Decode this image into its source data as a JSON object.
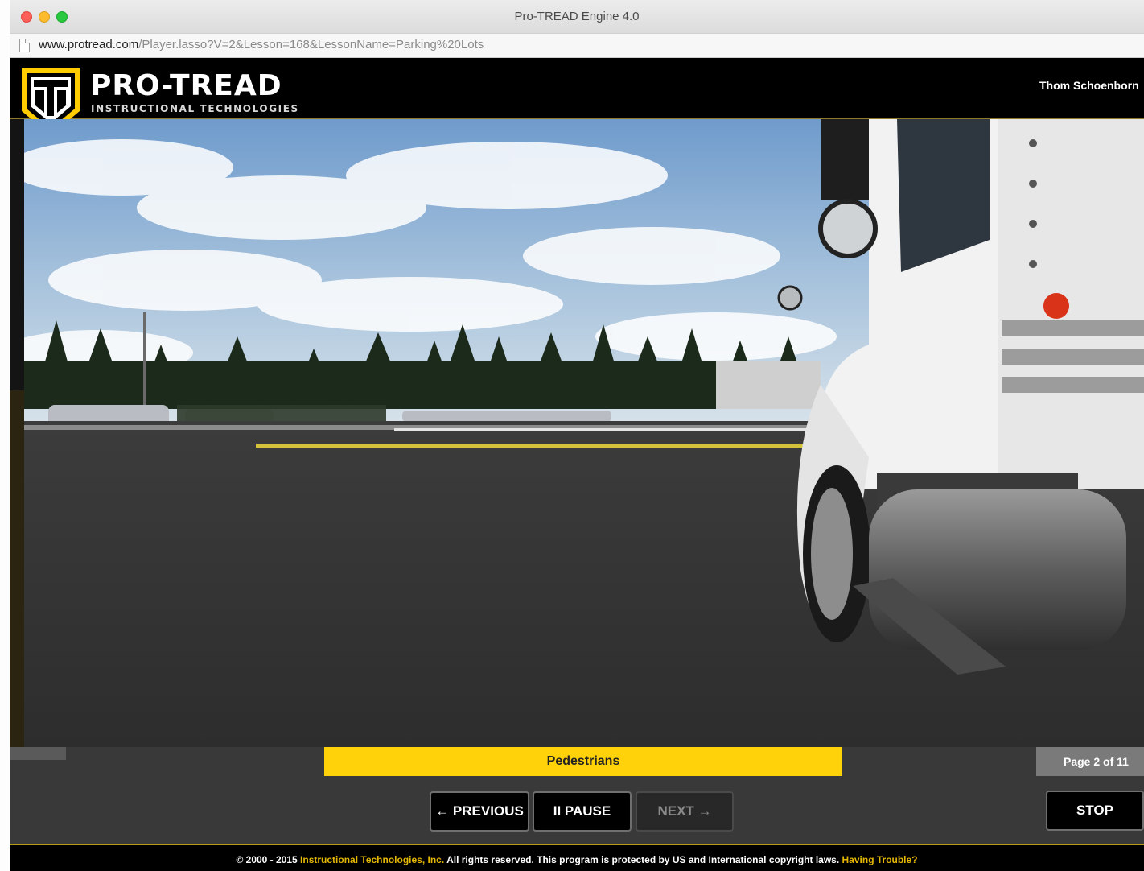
{
  "window": {
    "title": "Pro-TREAD Engine 4.0",
    "url_host": "www.protread.com",
    "url_path": "/Player.lasso?V=2&Lesson=168&LessonName=Parking%20Lots"
  },
  "header": {
    "brand_name": "PRO-TREAD",
    "brand_sub": "INSTRUCTIONAL TECHNOLOGIES",
    "user_name": "Thom Schoenborn"
  },
  "player": {
    "lesson_title": "Pedestrians",
    "page_indicator": "Page 2 of 11",
    "buttons": {
      "previous": "← PREVIOUS",
      "pause": "II PAUSE",
      "next": "NEXT →",
      "stop": "STOP"
    }
  },
  "footer": {
    "copyright": "© 2000 - 2015 ",
    "company_link": "Instructional Technologies, Inc.",
    "notice": " All rights reserved. This program is protected by US and International copyright laws. ",
    "help_link": "Having Trouble?"
  },
  "colors": {
    "accent_yellow": "#ffd20a",
    "header_black": "#000000",
    "control_bar": "#393939"
  },
  "icons": {
    "logo": "pro-tread-shield-logo",
    "page": "page-icon"
  }
}
